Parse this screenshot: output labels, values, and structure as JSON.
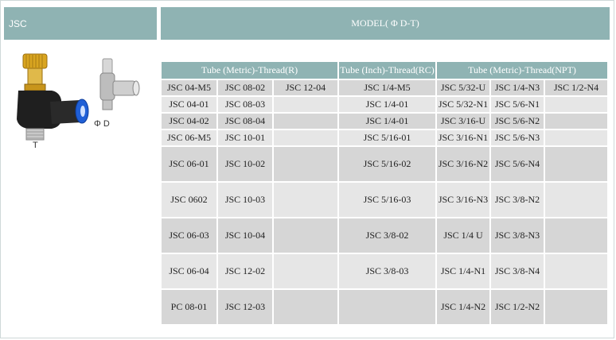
{
  "header": {
    "left_label": "JSC",
    "right_label": "MODEL( Φ D-T)"
  },
  "image": {
    "label_d": "Φ D",
    "label_t": "T"
  },
  "table": {
    "groups": [
      "Tube (Metric)-Thread(R)",
      "Tube (Inch)-Thread(RC)",
      "Tube (Metric)-Thread(NPT)"
    ],
    "rows": [
      [
        "JSC 04-M5",
        "JSC 08-02",
        "JSC 12-04",
        "JSC 1/4-M5",
        "JSC 5/32-U",
        "JSC 1/4-N3",
        "JSC 1/2-N4"
      ],
      [
        "JSC 04-01",
        "JSC 08-03",
        "",
        "JSC 1/4-01",
        "JSC 5/32-N1",
        "JSC 5/6-N1",
        ""
      ],
      [
        "JSC 04-02",
        "JSC 08-04",
        "",
        "JSC 1/4-01",
        "JSC 3/16-U",
        "JSC 5/6-N2",
        ""
      ],
      [
        "JSC 06-M5",
        "JSC 10-01",
        "",
        "JSC 5/16-01",
        "JSC 3/16-N1",
        "JSC 5/6-N3",
        ""
      ],
      [
        "JSC 06-01",
        "JSC 10-02",
        "",
        "JSC 5/16-02",
        "JSC 3/16-N2",
        "JSC 5/6-N4",
        ""
      ],
      [
        "JSC 0602",
        "JSC 10-03",
        "",
        "JSC 5/16-03",
        "JSC 3/16-N3",
        "JSC 3/8-N2",
        ""
      ],
      [
        "JSC 06-03",
        "JSC 10-04",
        "",
        "JSC 3/8-02",
        "JSC 1/4 U",
        "JSC 3/8-N3",
        ""
      ],
      [
        "JSC 06-04",
        "JSC 12-02",
        "",
        "JSC 3/8-03",
        "JSC 1/4-N1",
        "JSC 3/8-N4",
        ""
      ],
      [
        "PC 08-01",
        "JSC 12-03",
        "",
        "",
        "JSC 1/4-N2",
        "JSC 1/2-N2",
        ""
      ]
    ]
  }
}
